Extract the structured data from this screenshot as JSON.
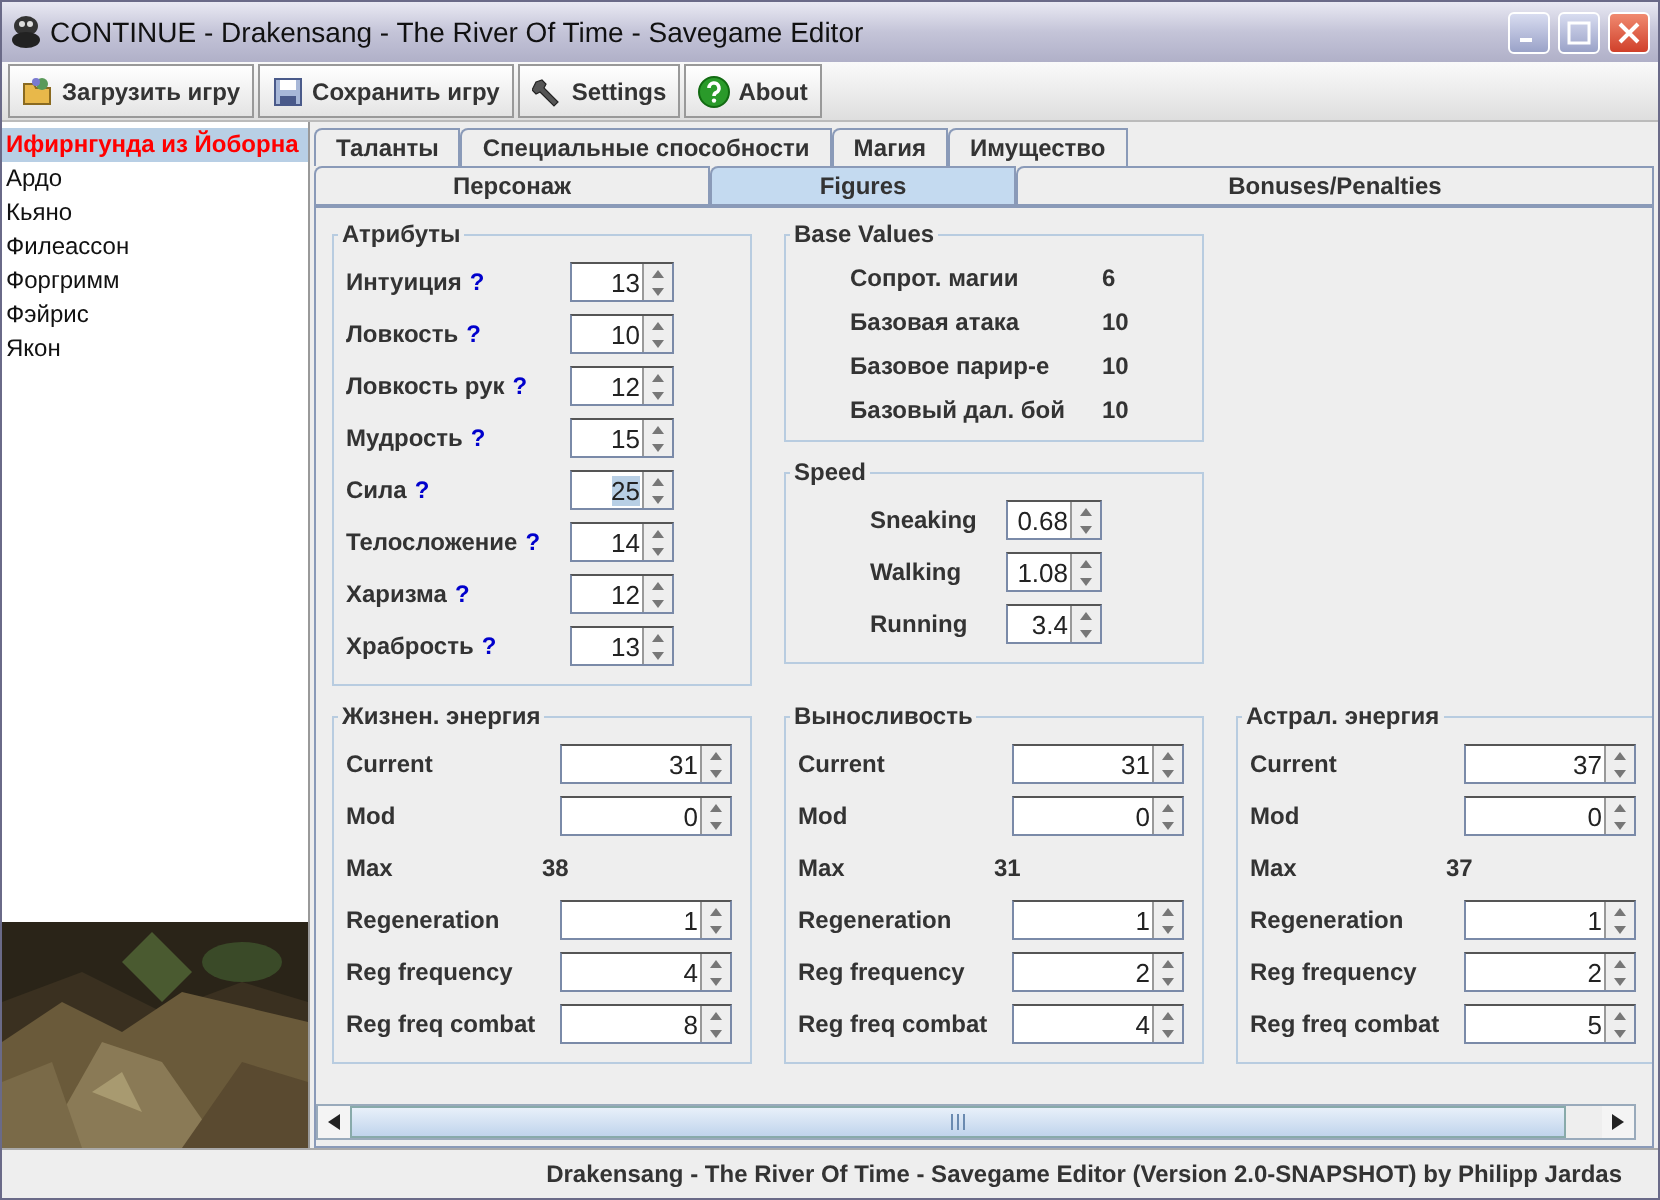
{
  "window": {
    "title": "CONTINUE - Drakensang - The River Of Time - Savegame Editor"
  },
  "toolbar": {
    "buttons": [
      {
        "label": "Загрузить игру"
      },
      {
        "label": "Сохранить игру"
      },
      {
        "label": "Settings"
      },
      {
        "label": "About"
      }
    ]
  },
  "characters": [
    {
      "name": "Ифирнгунда из Йоборна",
      "selected": true
    },
    {
      "name": "Ардо",
      "selected": false
    },
    {
      "name": "Кьяно",
      "selected": false
    },
    {
      "name": "Филеассон",
      "selected": false
    },
    {
      "name": "Форгримм",
      "selected": false
    },
    {
      "name": "Фэйрис",
      "selected": false
    },
    {
      "name": "Якон",
      "selected": false
    }
  ],
  "tabs_row_1": [
    {
      "label": "Таланты",
      "selected": false
    },
    {
      "label": "Специальные способности",
      "selected": false
    },
    {
      "label": "Магия",
      "selected": false
    },
    {
      "label": "Имущество",
      "selected": false
    }
  ],
  "tabs_row_2": [
    {
      "label": "Персонаж",
      "selected": false
    },
    {
      "label": "Figures",
      "selected": true
    },
    {
      "label": "Bonuses/Penalties",
      "selected": false
    }
  ],
  "attributes": {
    "title": "Атрибуты",
    "rows": [
      {
        "label": "Интуиция",
        "help": "?",
        "value": "13",
        "selected": false
      },
      {
        "label": "Ловкость",
        "help": "?",
        "value": "10",
        "selected": false
      },
      {
        "label": "Ловкость рук",
        "help": "?",
        "value": "12",
        "selected": false
      },
      {
        "label": "Мудрость",
        "help": "?",
        "value": "15",
        "selected": false
      },
      {
        "label": "Сила",
        "help": "?",
        "value": "25",
        "selected": true
      },
      {
        "label": "Телосложение",
        "help": "?",
        "value": "14",
        "selected": false
      },
      {
        "label": "Харизма",
        "help": "?",
        "value": "12",
        "selected": false
      },
      {
        "label": "Храбрость",
        "help": "?",
        "value": "13",
        "selected": false
      }
    ]
  },
  "base_values": {
    "title": "Base Values",
    "rows": [
      {
        "label": "Сопрот. магии",
        "value": "6"
      },
      {
        "label": "Базовая атака",
        "value": "10"
      },
      {
        "label": "Базовое парир-е",
        "value": "10"
      },
      {
        "label": "Базовый дал. бой",
        "value": "10"
      }
    ]
  },
  "speed": {
    "title": "Speed",
    "rows": [
      {
        "label": "Sneaking",
        "value": "0.68"
      },
      {
        "label": "Walking",
        "value": "1.08"
      },
      {
        "label": "Running",
        "value": "3.4"
      }
    ]
  },
  "energy_groups": [
    {
      "title": "Жизнен. энергия",
      "rows": [
        {
          "label": "Current",
          "value": "31",
          "kind": "spinner"
        },
        {
          "label": "Mod",
          "value": "0",
          "kind": "spinner"
        },
        {
          "label": "Max",
          "value": "38",
          "kind": "text"
        },
        {
          "label": "Regeneration",
          "value": "1",
          "kind": "spinner"
        },
        {
          "label": "Reg frequency",
          "value": "4",
          "kind": "spinner"
        },
        {
          "label": "Reg freq combat",
          "value": "8",
          "kind": "spinner"
        }
      ]
    },
    {
      "title": "Выносливость",
      "rows": [
        {
          "label": "Current",
          "value": "31",
          "kind": "spinner"
        },
        {
          "label": "Mod",
          "value": "0",
          "kind": "spinner"
        },
        {
          "label": "Max",
          "value": "31",
          "kind": "text"
        },
        {
          "label": "Regeneration",
          "value": "1",
          "kind": "spinner"
        },
        {
          "label": "Reg frequency",
          "value": "2",
          "kind": "spinner"
        },
        {
          "label": "Reg freq combat",
          "value": "4",
          "kind": "spinner"
        }
      ]
    },
    {
      "title": "Астрал. энергия",
      "rows": [
        {
          "label": "Current",
          "value": "37",
          "kind": "spinner"
        },
        {
          "label": "Mod",
          "value": "0",
          "kind": "spinner"
        },
        {
          "label": "Max",
          "value": "37",
          "kind": "text"
        },
        {
          "label": "Regeneration",
          "value": "1",
          "kind": "spinner"
        },
        {
          "label": "Reg frequency",
          "value": "2",
          "kind": "spinner"
        },
        {
          "label": "Reg freq combat",
          "value": "5",
          "kind": "spinner"
        }
      ]
    }
  ],
  "status_bar": {
    "text": "Drakensang - The River Of Time - Savegame Editor (Version 2.0-SNAPSHOT) by Philipp Jardas"
  }
}
